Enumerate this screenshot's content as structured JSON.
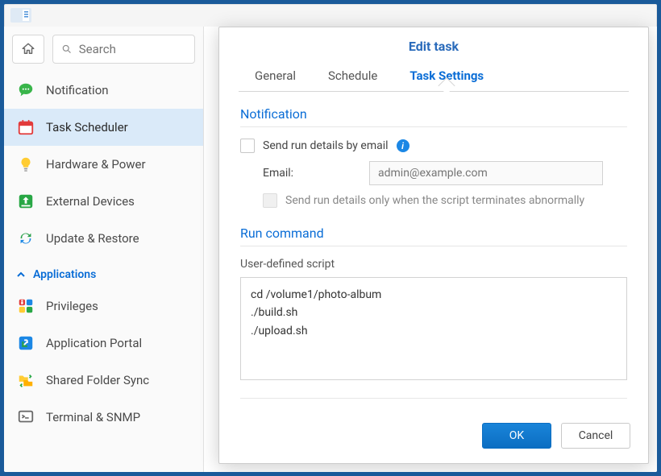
{
  "search": {
    "placeholder": "Search"
  },
  "sidebar": {
    "items": [
      {
        "label": "Notification"
      },
      {
        "label": "Task Scheduler"
      },
      {
        "label": "Hardware & Power"
      },
      {
        "label": "External Devices"
      },
      {
        "label": "Update & Restore"
      }
    ],
    "section_header": "Applications",
    "apps": [
      {
        "label": "Privileges"
      },
      {
        "label": "Application Portal"
      },
      {
        "label": "Shared Folder Sync"
      },
      {
        "label": "Terminal & SNMP"
      }
    ]
  },
  "modal": {
    "title": "Edit task",
    "tabs": [
      {
        "label": "General"
      },
      {
        "label": "Schedule"
      },
      {
        "label": "Task Settings"
      }
    ],
    "notification": {
      "section_title": "Notification",
      "send_details_label": "Send run details by email",
      "email_label": "Email:",
      "email_placeholder": "admin@example.com",
      "abnormal_label": "Send run details only when the script terminates abnormally"
    },
    "run": {
      "section_title": "Run command",
      "script_label": "User-defined script",
      "script_value": "cd /volume1/photo-album\n./build.sh\n./upload.sh"
    },
    "buttons": {
      "ok": "OK",
      "cancel": "Cancel"
    }
  }
}
